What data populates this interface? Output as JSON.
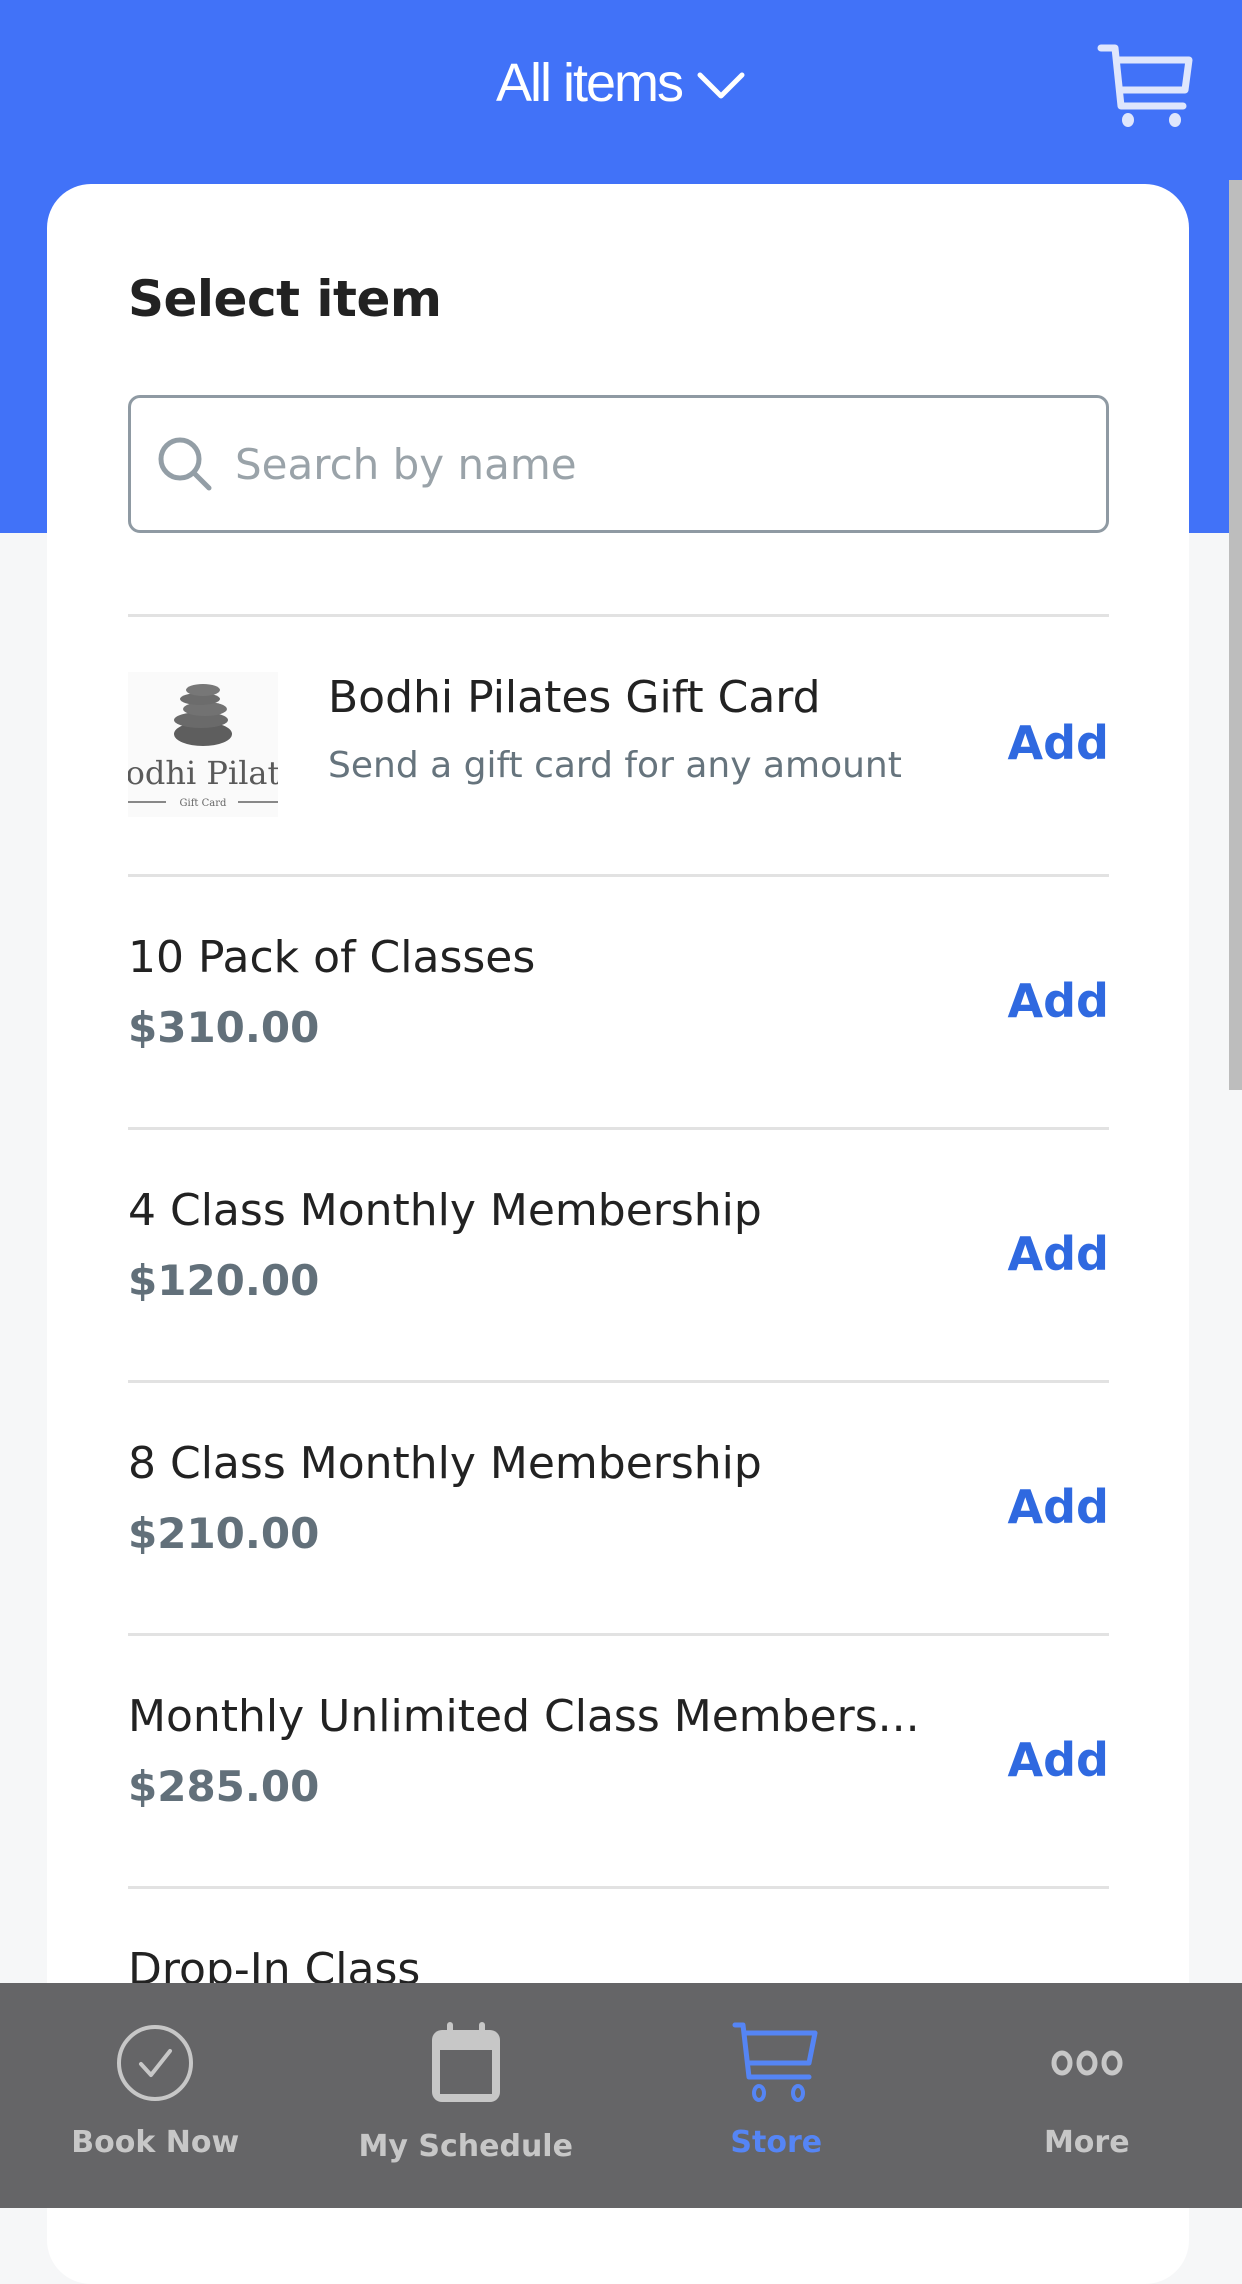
{
  "header": {
    "title": "All items",
    "title_icon": "chevron-down-icon",
    "cart_icon": "cart-icon",
    "brand_color": "#4172f8"
  },
  "card": {
    "title": "Select item",
    "search": {
      "placeholder": "Search by name",
      "value": "",
      "icon": "search-icon"
    }
  },
  "items": [
    {
      "name": "Bodhi Pilates Gift Card",
      "description": "Send a gift card for any amount",
      "image_text": "odhi Pilat",
      "image_subtext": "Gift Card",
      "action": "Add"
    },
    {
      "name": "10 Pack of Classes",
      "price": "$310.00",
      "action": "Add"
    },
    {
      "name": "4 Class Monthly Membership",
      "price": "$120.00",
      "action": "Add"
    },
    {
      "name": "8 Class Monthly Membership",
      "price": "$210.00",
      "action": "Add"
    },
    {
      "name": "Monthly Unlimited Class Members...",
      "price": "$285.00",
      "action": "Add"
    },
    {
      "name": "Drop-In Class"
    }
  ],
  "tabbar": {
    "active_color": "#5585f5",
    "tabs": [
      {
        "label": "Book Now",
        "icon": "check-circle-icon",
        "active": false
      },
      {
        "label": "My Schedule",
        "icon": "calendar-icon",
        "active": false
      },
      {
        "label": "Store",
        "icon": "cart-icon",
        "active": true
      },
      {
        "label": "More",
        "icon": "more-dots-icon",
        "active": false
      }
    ]
  }
}
